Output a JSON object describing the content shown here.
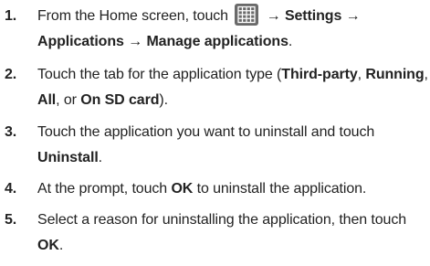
{
  "steps": [
    {
      "number": "1.",
      "line1": {
        "a": "From the Home screen, touch",
        "arrow1": "→",
        "settings": "Settings",
        "arrow2": "→"
      },
      "line2": {
        "applications": "Applications",
        "arrow": "→",
        "manage": "Manage applications",
        "period": "."
      },
      "icon": "apps-grid-icon"
    },
    {
      "number": "2.",
      "line1": {
        "a": "Touch the tab for the application type (",
        "third_party": "Third-party",
        "comma1": ", ",
        "running": "Running",
        "comma2": ","
      },
      "line2": {
        "all": "All",
        "or": ", or ",
        "sd": "On SD card",
        "close": ")."
      }
    },
    {
      "number": "3.",
      "line1": "Touch the application you want to uninstall and touch",
      "line2": {
        "uninstall": "Uninstall",
        "period": "."
      }
    },
    {
      "number": "4.",
      "line1": {
        "a": "At the prompt, touch ",
        "ok": "OK",
        "b": " to uninstall the application."
      }
    },
    {
      "number": "5.",
      "line1": "Select a reason for uninstalling the application, then touch",
      "line2": {
        "ok": "OK",
        "period": "."
      }
    }
  ]
}
